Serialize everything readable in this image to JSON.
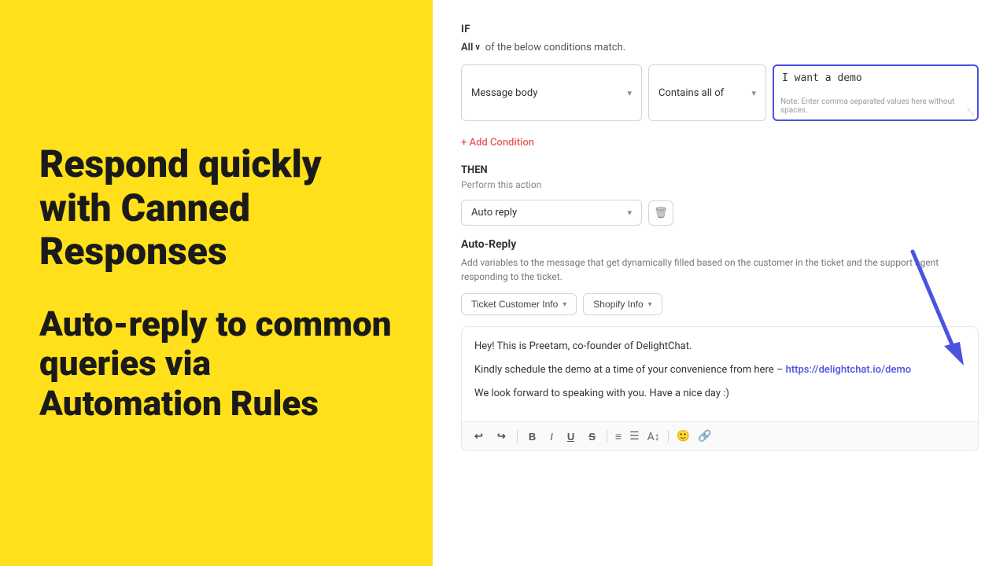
{
  "left": {
    "heading1": "Respond quickly with Canned Responses",
    "heading2": "Auto-reply to common queries via Automation Rules"
  },
  "right": {
    "if_label": "IF",
    "all_text": "All",
    "conditions_suffix": "of the below conditions match.",
    "condition": {
      "message_body": "Message body",
      "contains_all_of": "Contains all of",
      "value": "I want a demo",
      "note": "Note: Enter comma separated values here without spaces."
    },
    "add_condition": "+ Add Condition",
    "then_label": "THEN",
    "perform_action": "Perform this action",
    "action_select": "Auto reply",
    "auto_reply_section": {
      "title": "Auto-Reply",
      "description": "Add variables to the message that get dynamically filled based on the customer in the ticket and the support agent responding to the ticket.",
      "variable_btn1": "Ticket Customer Info",
      "variable_btn2": "Shopify Info"
    },
    "message": {
      "line1": "Hey! This is Preetam, co-founder of DelightChat.",
      "line2_prefix": "Kindly schedule the demo at a time of your convenience from here – ",
      "line2_link": "https://delightchat.io/demo",
      "line3": "We look forward to speaking with you. Have a nice day :)"
    },
    "toolbar": {
      "undo": "↩",
      "redo": "↪",
      "bold": "B",
      "italic": "I",
      "underline": "U",
      "strike": "S"
    }
  }
}
